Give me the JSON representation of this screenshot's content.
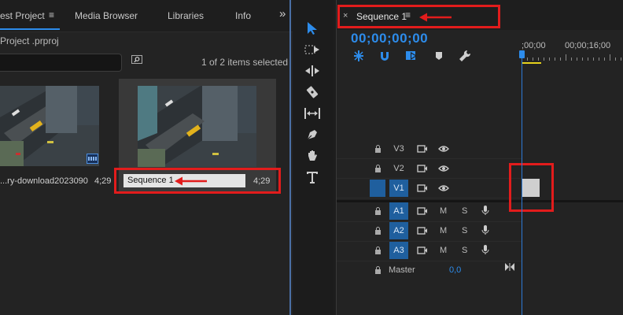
{
  "project_panel": {
    "tabs": [
      {
        "label": "est Project"
      },
      {
        "label": "Media Browser"
      },
      {
        "label": "Libraries"
      },
      {
        "label": "Info"
      }
    ],
    "tab_menu_glyph": "≡",
    "overflow_glyph": "»",
    "project_file": " Project .prproj",
    "search_placeholder": "",
    "items_count": "1 of 2 items selected",
    "clips": [
      {
        "name": "ry-download2023090...",
        "duration": "4;29"
      },
      {
        "name": "Sequence 1",
        "duration": "4;29"
      }
    ]
  },
  "timeline": {
    "close_glyph": "×",
    "sequence_title": "Sequence 1",
    "menu_glyph": "≡",
    "timecode": "00;00;00;00",
    "ruler_labels": [
      ";00;00",
      "00;00;16;00"
    ],
    "video_tracks": [
      {
        "label": "V3",
        "active": false
      },
      {
        "label": "V2",
        "active": false
      },
      {
        "label": "V1",
        "active": true
      }
    ],
    "audio_tracks": [
      {
        "label": "A1",
        "m": "M",
        "s": "S"
      },
      {
        "label": "A2",
        "m": "M",
        "s": "S"
      },
      {
        "label": "A3",
        "m": "M",
        "s": "S"
      }
    ],
    "master_label": "Master",
    "master_value": "0,0"
  },
  "tools": [
    "selection-tool",
    "track-select-tool",
    "ripple-edit-tool",
    "razor-tool",
    "slip-tool",
    "pen-tool",
    "hand-tool",
    "type-tool"
  ],
  "colors": {
    "accent": "#2d8ceb",
    "annotation_red": "#e21c1c",
    "track_active": "#1f5f9e"
  }
}
